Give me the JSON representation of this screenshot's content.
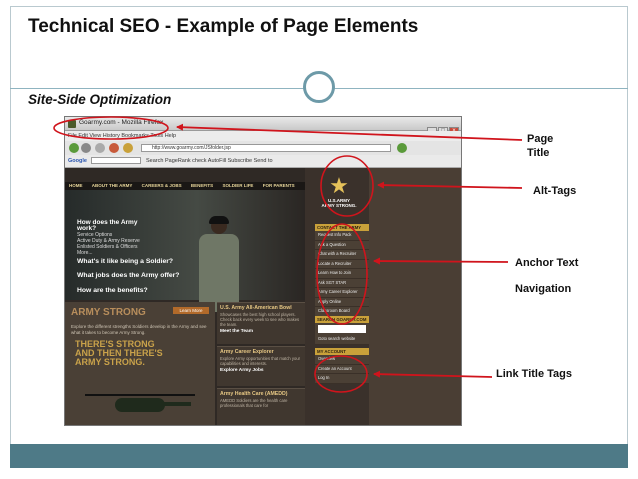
{
  "slide": {
    "title": "Technical SEO - Example of Page Elements",
    "subtitle": "Site-Side Optimization"
  },
  "annotations": {
    "page_title": [
      "Page",
      "Title"
    ],
    "alt_tags": "Alt-Tags",
    "anchor_text": "Anchor Text",
    "navigation": "Navigation",
    "link_title_tags": "Link Title Tags"
  },
  "browser": {
    "window_title": "Goarmy.com - Mozilla Firefox",
    "menubar": "File  Edit  View  History  Bookmarks  Tools  Help",
    "url": "http://www.goarmy.com/JSfolder.jsp",
    "google_label": "Google",
    "google_toolbar": "Search  PageRank  check  AutoFill  Subscribe  Send to"
  },
  "site": {
    "nav": [
      "HOME",
      "ABOUT THE ARMY",
      "CAREERS & JOBS",
      "BENEFITS",
      "SOLDIER LIFE",
      "FOR PARENTS"
    ],
    "work_heading": "How does the Army work?",
    "work_links": [
      "Service Options",
      "Active Duty & Army Reserve",
      "Enlisted Soldiers & Officers",
      "More..."
    ],
    "questions": [
      "What's it like being a Soldier?",
      "What jobs does the Army offer?",
      "How are the benefits?"
    ],
    "promo_heading": "ARMY STRONG",
    "promo_button": "Learn More",
    "promo_text": "Explore the different strengths Soldiers develop in the Army and see what it takes to become Army Strong.",
    "promo_big": [
      "THERE'S STRONG",
      "AND THEN THERE'S",
      "ARMY STRONG."
    ],
    "cards": [
      {
        "heading": "U.S. Army All-American Bowl",
        "text": "Showcases the best high school players. Check back every week to see who makes the team.",
        "link": "Meet the Team"
      },
      {
        "heading": "Army Career Explorer",
        "text": "Explore Army opportunities that match your capabilities and interests.",
        "link": "Explore Army Jobs"
      },
      {
        "heading": "Army Health Care (AMEDD)",
        "text": "AMEDD Soldiers are the health care professionals that care for",
        "link": ""
      }
    ],
    "logo_text": [
      "U.S.ARMY",
      "ARMY STRONG."
    ],
    "contact_header": "CONTACT THE ARMY",
    "contact_links": [
      "Request Info Pack",
      "Ask a Question",
      "Chat with a Recruiter",
      "Locate a Recruiter",
      "Learn How to Join",
      "Ask SGT STAR",
      "Army Career Explorer",
      "Apply Online",
      "Classroom Board"
    ],
    "search_header": "SEARCH GOARMY.COM",
    "search_link": "Goto search website",
    "account_header": "MY ACCOUNT",
    "account_links": [
      "Overview",
      "Create an Account",
      "Log In"
    ]
  },
  "colors": {
    "accent_red": "#d0141c",
    "frame": "#6d9aa8",
    "footer": "#4e7a87",
    "army_gold": "#c9a13a"
  }
}
